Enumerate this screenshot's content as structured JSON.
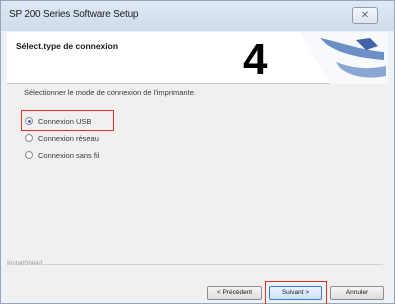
{
  "window": {
    "title": "SP 200 Series Software Setup",
    "close_glyph": "✕"
  },
  "header": {
    "title": "Sélect.type de connexion",
    "step_number": "4"
  },
  "instruction": "Sélectionner le mode de connexion de l'imprimante.",
  "options": [
    {
      "label": "Connexion USB",
      "checked": true
    },
    {
      "label": "Connexion réseau",
      "checked": false
    },
    {
      "label": "Connexion sans fil",
      "checked": false
    }
  ],
  "footer": {
    "installshield": "InstallShield",
    "prev": "< Précédent",
    "next": "Suivant >",
    "cancel": "Annuler"
  },
  "colors": {
    "highlight": "#e0302a",
    "accent": "#3a6fc4"
  }
}
